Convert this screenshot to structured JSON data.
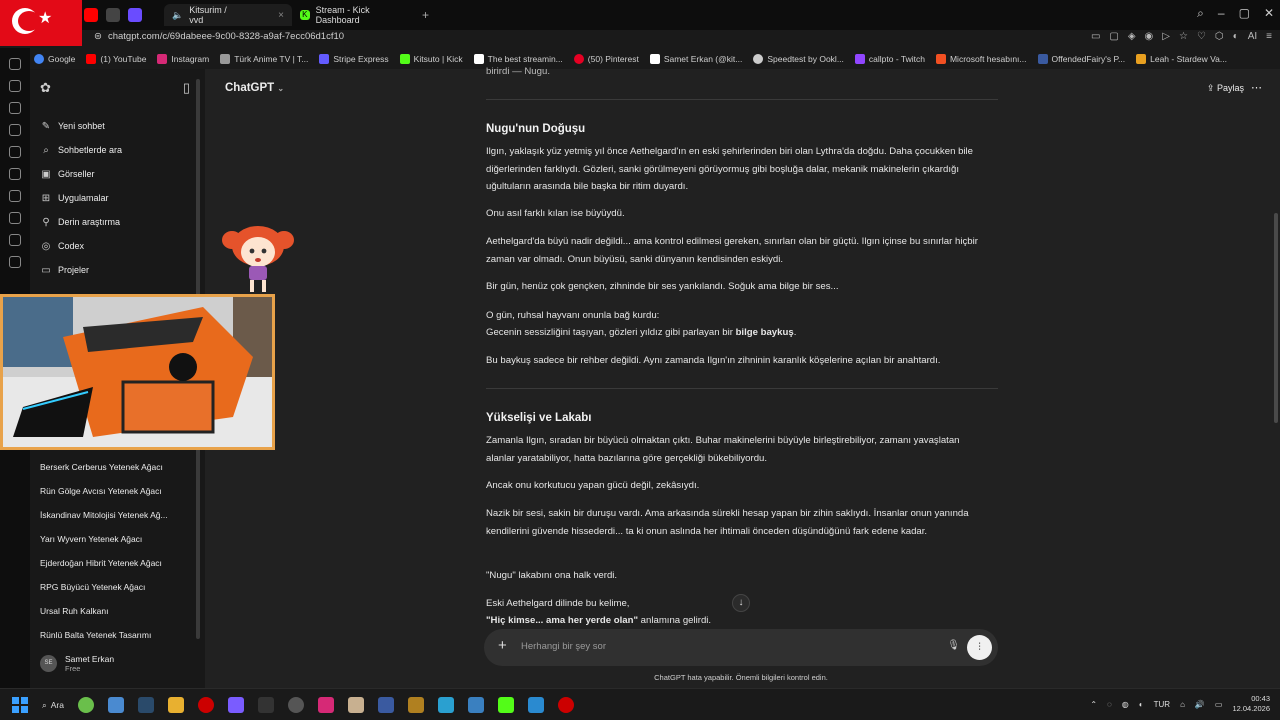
{
  "browser": {
    "tabs": [
      {
        "label": "Kitsurim / vvd",
        "active": true
      },
      {
        "label": "Stream - Kick Dashboard",
        "active": false
      }
    ],
    "url": "chatgpt.com/c/69dabeee-9c00-8328-a9af-7ecc06d1cf10",
    "bookmarks": [
      {
        "label": "Google",
        "color": "#4285f4"
      },
      {
        "label": "(1) YouTube",
        "color": "#ff0000"
      },
      {
        "label": "Instagram",
        "color": "#d62976"
      },
      {
        "label": "Türk Anime TV | T...",
        "color": "#999999"
      },
      {
        "label": "Stripe Express",
        "color": "#635bff"
      },
      {
        "label": "Kitsuto | Kick",
        "color": "#53fc18"
      },
      {
        "label": "The best streamin...",
        "color": "#ffffff"
      },
      {
        "label": "(50) Pinterest",
        "color": "#e60023"
      },
      {
        "label": "Samet Erkan (@kit...",
        "color": "#ffffff"
      },
      {
        "label": "Speedtest by Ookl...",
        "color": "#cccccc"
      },
      {
        "label": "callpto - Twitch",
        "color": "#9146ff"
      },
      {
        "label": "Microsoft hesabını...",
        "color": "#f25022"
      },
      {
        "label": "OffendedFairy's P...",
        "color": "#3a5aa0"
      },
      {
        "label": "Leah - Stardew Va...",
        "color": "#e8a020"
      }
    ]
  },
  "sidebar": {
    "menu": [
      {
        "label": "Yeni sohbet",
        "icon": "✎"
      },
      {
        "label": "Sohbetlerde ara",
        "icon": "⌕"
      },
      {
        "label": "Görseller",
        "icon": "▣"
      },
      {
        "label": "Uygulamalar",
        "icon": "⊞"
      },
      {
        "label": "Derin araştırma",
        "icon": "⚲"
      },
      {
        "label": "Codex",
        "icon": "◎"
      },
      {
        "label": "Projeler",
        "icon": "▭"
      }
    ],
    "chats": [
      "Berserk Cerberus Yetenek Ağacı",
      "Rün Gölge Avcısı Yetenek Ağacı",
      "İskandinav Mitolojisi Yetenek Ağ...",
      "Yarı Wyvern Yetenek Ağacı",
      "Ejderdoğan Hibrit Yetenek Ağacı",
      "RPG Büyücü Yetenek Ağacı",
      "Ursal Ruh Kalkanı",
      "Rünlü Balta Yetenek Tasarımı"
    ],
    "user": {
      "initials": "SE",
      "name": "Samet Erkan",
      "plan": "Free"
    }
  },
  "main": {
    "model": "ChatGPT",
    "share": "Paylaş",
    "top_fragment": "birirdi — Nugu.",
    "section1_title": "Nugu'nun Doğuşu",
    "s1_p1": "Ilgın, yaklaşık yüz yetmiş yıl önce Aethelgard'ın en eski şehirlerinden biri olan Lythra'da doğdu. Daha çocukken bile diğerlerinden farklıydı. Gözleri, sanki görülmeyeni görüyormuş gibi boşluğa dalar, mekanik makinelerin çıkardığı uğultuların arasında bile başka bir ritim duyardı.",
    "s1_p2": "Onu asıl farklı kılan ise büyüydü.",
    "s1_p3": "Aethelgard'da büyü nadir değildi... ama kontrol edilmesi gereken, sınırları olan bir güçtü. Ilgın içinse bu sınırlar hiçbir zaman var olmadı. Onun büyüsü, sanki dünyanın kendisinden eskiydi.",
    "s1_p4": "Bir gün, henüz çok gençken, zihninde bir ses yankılandı. Soğuk ama bilge bir ses...",
    "s1_p5a": "O gün, ruhsal hayvanı onunla bağ kurdu:",
    "s1_p5b": "Gecenin sessizliğini taşıyan, gözleri yıldız gibi parlayan bir ",
    "s1_p5b_bold": "bilge baykuş",
    "s1_p5b_end": ".",
    "s1_p6": "Bu baykuş sadece bir rehber değildi. Aynı zamanda Ilgın'ın zihninin karanlık köşelerine açılan bir anahtardı.",
    "section2_title": "Yükselişi ve Lakabı",
    "s2_p1": "Zamanla Ilgın, sıradan bir büyücü olmaktan çıktı. Buhar makinelerini büyüyle birleştirebiliyor, zamanı yavaşlatan alanlar yaratabiliyor, hatta bazılarına göre gerçekliği bükebiliyordu.",
    "s2_p2": "Ancak onu korkutucu yapan gücü değil, zekâsıydı.",
    "s2_p3": "Nazik bir sesi, sakin bir duruşu vardı. Ama arkasında sürekli hesap yapan bir zihin saklıydı. İnsanlar onun yanında kendilerini güvende hissederdi... ta ki onun aslında her ihtimali önceden düşündüğünü fark edene kadar.",
    "s2_p4": "\"Nugu\" lakabını ona halk verdi.",
    "s2_p5": "Eski Aethelgard dilinde bu kelime,",
    "s2_p6_bold": "\"Hiç kimse... ama her yerde olan\"",
    "s2_p6_rest": " anlamına gelirdi.",
    "composer_placeholder": "Herhangi bir şey sor",
    "footnote": "ChatGPT hata yapabilir. Önemli bilgileri kontrol edin."
  },
  "taskbar": {
    "search": "Ara",
    "lang": "TUR",
    "time": "00:43",
    "date": "12.04.2026"
  }
}
